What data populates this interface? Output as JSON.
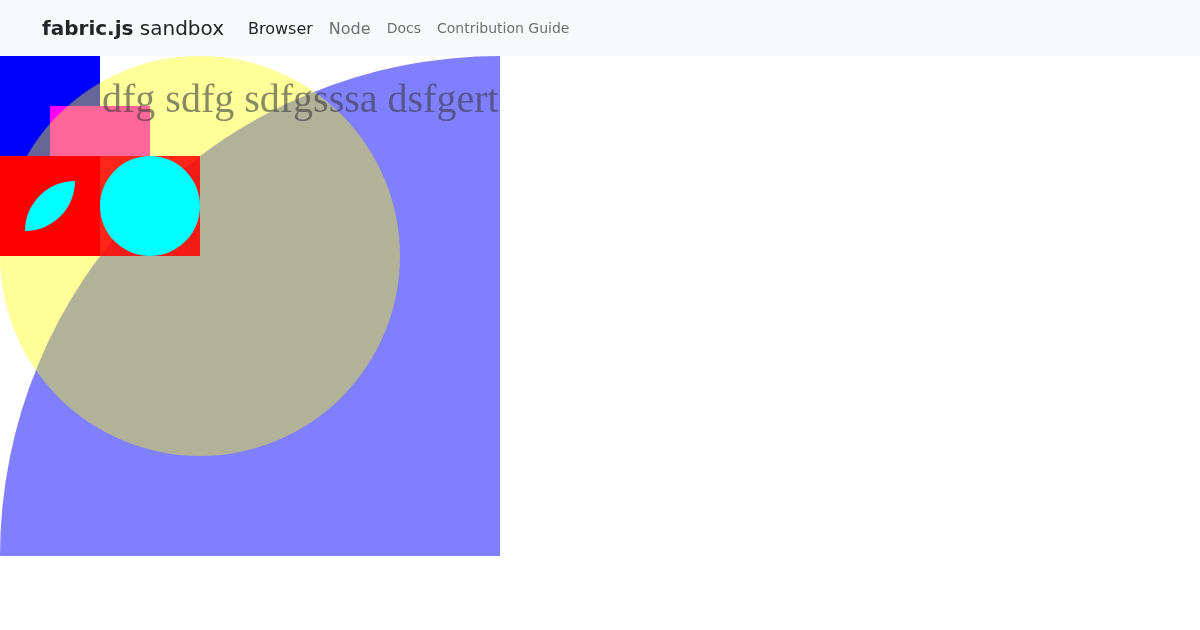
{
  "navbar": {
    "brand": "**fabric.js** sandbox",
    "links": [
      {
        "label": "Browser",
        "kind": "primary",
        "selected": true
      },
      {
        "label": "Node",
        "kind": "primary",
        "selected": false
      },
      {
        "label": "Docs",
        "kind": "secondary",
        "selected": false
      },
      {
        "label": "Contribution Guide",
        "kind": "secondary",
        "selected": false
      }
    ]
  },
  "canvas": {
    "text": "dfg sdfg sdfgsssa dsfgert"
  }
}
